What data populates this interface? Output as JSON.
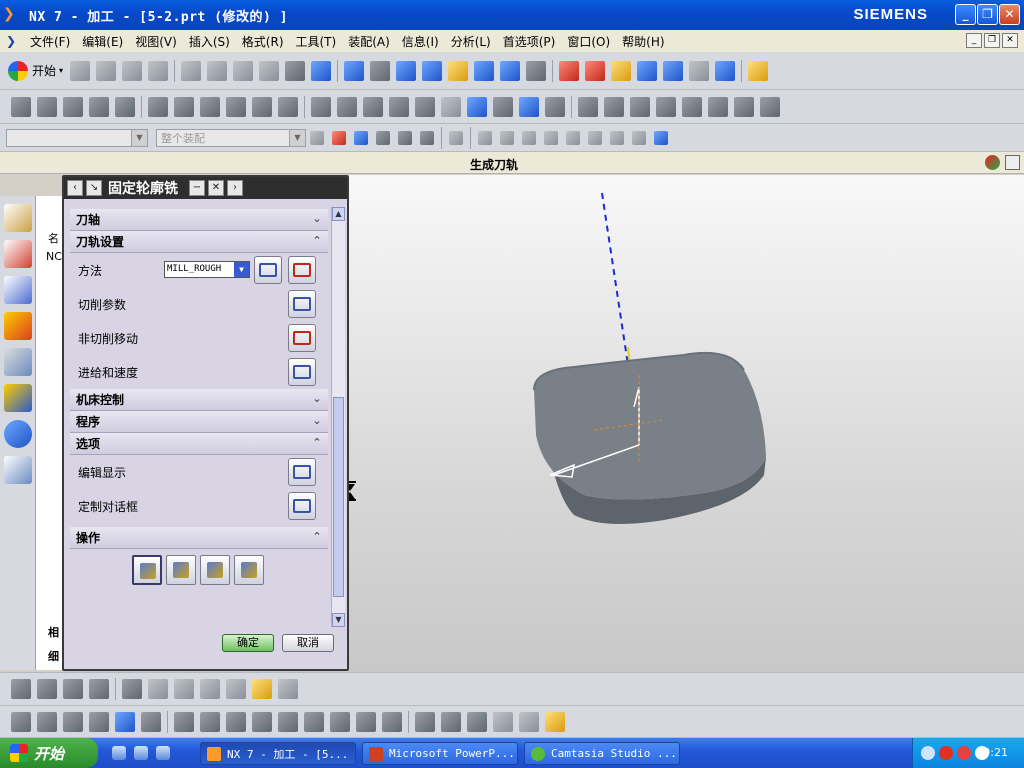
{
  "titlebar": {
    "title": "NX 7 - 加工 - [5-2.prt  (修改的) ]",
    "brand": "SIEMENS"
  },
  "menu": [
    "文件(F)",
    "编辑(E)",
    "视图(V)",
    "插入(S)",
    "格式(R)",
    "工具(T)",
    "装配(A)",
    "信息(I)",
    "分析(L)",
    "首选项(P)",
    "窗口(O)",
    "帮助(H)"
  ],
  "toolbar": {
    "start_label": "开始",
    "filter_placeholder": "整个装配"
  },
  "cue": "生成刀轨",
  "dialog": {
    "title": "固定轮廓铣",
    "sections": {
      "tool_axis": "刀轴",
      "path_settings": "刀轨设置",
      "machine_control": "机床控制",
      "program": "程序",
      "options": "选项",
      "actions": "操作"
    },
    "method_label": "方法",
    "method_value": "MILL_ROUGH",
    "cut_params": "切削参数",
    "non_cutting": "非切削移动",
    "feeds": "进给和速度",
    "edit_display": "编辑显示",
    "custom_dialog": "定制对话框",
    "ok": "确定",
    "cancel": "取消"
  },
  "navigator": {
    "col_name": "名",
    "row_no": "NC",
    "bottom1": "相",
    "bottom2": "细"
  },
  "taskbar": {
    "start": "开始",
    "tasks": [
      "NX 7 - 加工 - [5...",
      "Microsoft PowerP...",
      "Camtasia Studio ..."
    ],
    "clock": "0:21"
  },
  "colors": {
    "title_blue": "#0648c8",
    "taskbar_blue": "#2458d8",
    "dialog_bg": "#d8d4e4",
    "part_gray": "#6e747c"
  }
}
